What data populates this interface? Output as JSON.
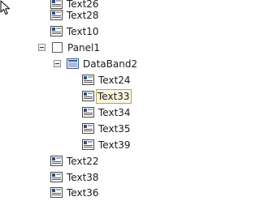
{
  "tree": {
    "nodes": [
      {
        "label": "Text26",
        "icon": "text-icon",
        "expander": false,
        "selected": false
      },
      {
        "label": "Text28",
        "icon": "text-icon",
        "expander": false,
        "selected": false
      },
      {
        "label": "Text10",
        "icon": "text-icon",
        "expander": false,
        "selected": false
      },
      {
        "label": "Panel1",
        "icon": "panel-icon",
        "expander": true,
        "selected": false
      },
      {
        "label": "DataBand2",
        "icon": "databand-icon",
        "expander": true,
        "selected": false
      },
      {
        "label": "Text24",
        "icon": "text-icon",
        "expander": false,
        "selected": false
      },
      {
        "label": "Text33",
        "icon": "text-icon",
        "expander": false,
        "selected": true
      },
      {
        "label": "Text34",
        "icon": "text-icon",
        "expander": false,
        "selected": false
      },
      {
        "label": "Text35",
        "icon": "text-icon",
        "expander": false,
        "selected": false
      },
      {
        "label": "Text39",
        "icon": "text-icon",
        "expander": false,
        "selected": false
      },
      {
        "label": "Text22",
        "icon": "text-icon",
        "expander": false,
        "selected": false
      },
      {
        "label": "Text38",
        "icon": "text-icon",
        "expander": false,
        "selected": false
      },
      {
        "label": "Text36",
        "icon": "text-icon",
        "expander": false,
        "selected": false
      }
    ]
  },
  "colors": {
    "selection_fill": "#fdf4e0",
    "selection_border": "#b7a06a"
  }
}
